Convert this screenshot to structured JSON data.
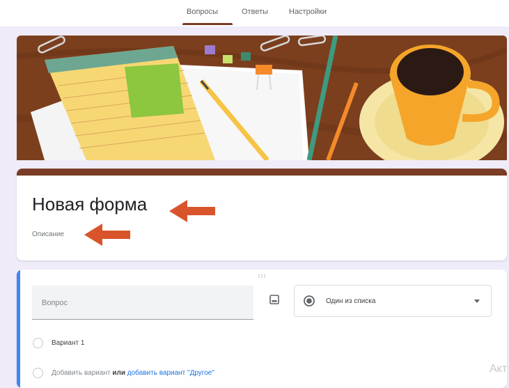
{
  "tabs": [
    {
      "label": "Вопросы",
      "active": true
    },
    {
      "label": "Ответы",
      "active": false
    },
    {
      "label": "Настройки",
      "active": false
    }
  ],
  "form": {
    "title": "Новая форма",
    "description": "Описание"
  },
  "question": {
    "placeholder": "Вопрос",
    "type_label": "Один из списка",
    "options": [
      "Вариант 1"
    ],
    "add_option": "Добавить вариант",
    "or": "или",
    "add_other": "добавить вариант \"Другое\""
  },
  "side_text": "Акт",
  "colors": {
    "theme": "#7a3d26",
    "arrow": "#d9542b",
    "accent_blue": "#4285f4",
    "link": "#1a73e8"
  },
  "icons": {
    "image": "image-icon",
    "radio": "radio-checked-icon",
    "chevron": "chevron-down-icon",
    "drag": "drag-handle-icon"
  }
}
